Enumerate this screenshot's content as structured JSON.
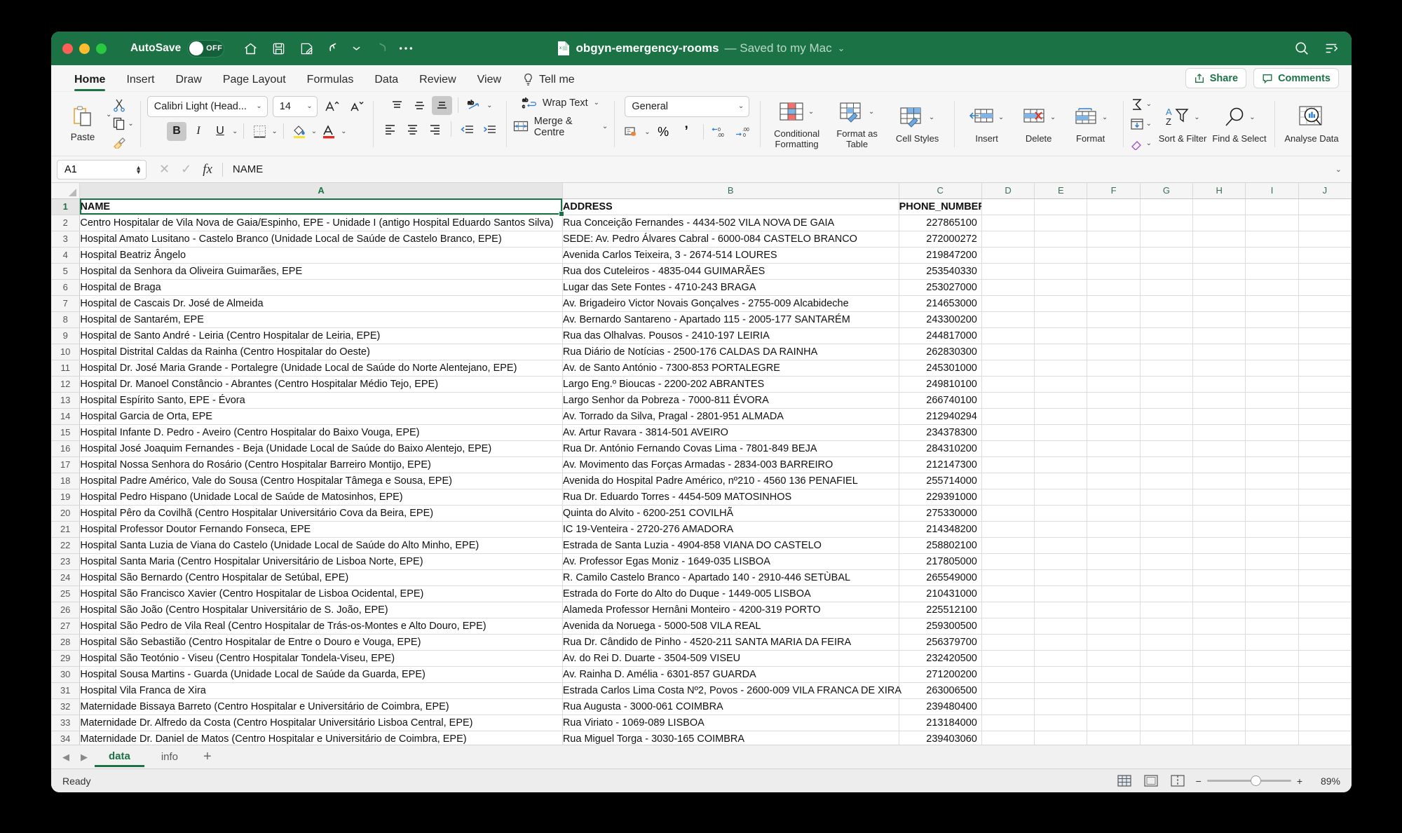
{
  "titlebar": {
    "autosave_label": "AutoSave",
    "autosave_state": "OFF",
    "doc_name": "obgyn-emergency-rooms",
    "doc_saved": "— Saved to my Mac",
    "quick_access": [
      "home-icon",
      "save-icon",
      "save-as-icon",
      "undo-icon",
      "redo-icon",
      "more-icon"
    ],
    "right_icons": [
      "search-icon",
      "ribbon-display-icon"
    ]
  },
  "tabs": [
    {
      "label": "Home",
      "active": true
    },
    {
      "label": "Insert",
      "active": false
    },
    {
      "label": "Draw",
      "active": false
    },
    {
      "label": "Page Layout",
      "active": false
    },
    {
      "label": "Formulas",
      "active": false
    },
    {
      "label": "Data",
      "active": false
    },
    {
      "label": "Review",
      "active": false
    },
    {
      "label": "View",
      "active": false
    }
  ],
  "tellme_label": "Tell me",
  "share_label": "Share",
  "comments_label": "Comments",
  "ribbon": {
    "paste_label": "Paste",
    "font_name": "Calibri Light (Head...",
    "font_size": "14",
    "bold_label": "B",
    "italic_label": "I",
    "underline_label": "U",
    "wrap_text_label": "Wrap Text",
    "merge_label": "Merge & Centre",
    "number_format": "General",
    "percent_label": "%",
    "comma_label": "’",
    "conditional_formatting_label": "Conditional Formatting",
    "format_as_table_label": "Format as Table",
    "cell_styles_label": "Cell Styles",
    "insert_label": "Insert",
    "delete_label": "Delete",
    "format_label": "Format",
    "sort_filter_label": "Sort & Filter",
    "find_select_label": "Find & Select",
    "analyse_data_label": "Analyse Data"
  },
  "formula_bar": {
    "name_box": "A1",
    "formula_value": "NAME"
  },
  "grid": {
    "columns": [
      "A",
      "B",
      "C",
      "D",
      "E",
      "F",
      "G",
      "H",
      "I",
      "J"
    ],
    "selected_column": "A",
    "selected_row": 1,
    "rows": [
      {
        "n": 1,
        "a": "NAME",
        "b": "ADDRESS",
        "c": "PHONE_NUMBER",
        "header": true
      },
      {
        "n": 2,
        "a": "Centro Hospitalar de Vila Nova de Gaia/Espinho, EPE - Unidade I (antigo Hospital Eduardo Santos Silva)",
        "b": "Rua Conceição Fernandes - 4434-502 VILA NOVA DE GAIA",
        "c": "227865100"
      },
      {
        "n": 3,
        "a": "Hospital Amato Lusitano - Castelo Branco (Unidade Local de Saúde de Castelo Branco, EPE)",
        "b": "SEDE: Av. Pedro Álvares Cabral - 6000-084 CASTELO BRANCO",
        "c": "272000272"
      },
      {
        "n": 4,
        "a": "Hospital Beatriz Ângelo",
        "b": "Avenida Carlos Teixeira, 3 - 2674-514 LOURES",
        "c": "219847200"
      },
      {
        "n": 5,
        "a": "Hospital da Senhora da Oliveira Guimarães, EPE",
        "b": "Rua dos Cuteleiros - 4835-044 GUIMARÃES",
        "c": "253540330"
      },
      {
        "n": 6,
        "a": "Hospital de Braga",
        "b": "Lugar das Sete Fontes - 4710-243 BRAGA",
        "c": "253027000"
      },
      {
        "n": 7,
        "a": "Hospital de Cascais Dr. José de Almeida",
        "b": "Av. Brigadeiro Victor Novais Gonçalves - 2755-009 Alcabideche",
        "c": "214653000"
      },
      {
        "n": 8,
        "a": "Hospital de Santarém, EPE",
        "b": "Av. Bernardo Santareno - Apartado 115 - 2005-177 SANTARÉM",
        "c": "243300200"
      },
      {
        "n": 9,
        "a": "Hospital de Santo André - Leiria (Centro Hospitalar de Leiria, EPE)",
        "b": "Rua das Olhalvas. Pousos - 2410-197 LEIRIA",
        "c": "244817000"
      },
      {
        "n": 10,
        "a": "Hospital Distrital Caldas da Rainha (Centro Hospitalar do Oeste)",
        "b": "Rua Diário de Notícias - 2500-176 CALDAS DA RAINHA",
        "c": "262830300"
      },
      {
        "n": 11,
        "a": "Hospital Dr. José Maria Grande - Portalegre (Unidade Local de Saúde do Norte Alentejano, EPE)",
        "b": "Av. de Santo António - 7300-853 PORTALEGRE",
        "c": "245301000"
      },
      {
        "n": 12,
        "a": "Hospital Dr. Manoel Constâncio - Abrantes (Centro Hospitalar Médio Tejo, EPE)",
        "b": "Largo Eng.º Bioucas - 2200-202 ABRANTES",
        "c": "249810100"
      },
      {
        "n": 13,
        "a": "Hospital Espírito Santo, EPE - Évora",
        "b": "Largo Senhor da Pobreza - 7000-811 ÉVORA",
        "c": "266740100"
      },
      {
        "n": 14,
        "a": "Hospital Garcia de Orta, EPE",
        "b": "Av. Torrado da Silva, Pragal - 2801-951 ALMADA",
        "c": "212940294"
      },
      {
        "n": 15,
        "a": "Hospital Infante D. Pedro - Aveiro (Centro Hospitalar do Baixo Vouga, EPE)",
        "b": "Av. Artur Ravara - 3814-501 AVEIRO",
        "c": "234378300"
      },
      {
        "n": 16,
        "a": "Hospital José Joaquim Fernandes - Beja (Unidade Local de Saúde do Baixo Alentejo, EPE)",
        "b": "Rua Dr. António Fernando Covas Lima - 7801-849 BEJA",
        "c": "284310200"
      },
      {
        "n": 17,
        "a": "Hospital Nossa Senhora do Rosário (Centro Hospitalar Barreiro Montijo, EPE)",
        "b": "Av. Movimento das Forças Armadas - 2834-003 BARREIRO",
        "c": "212147300"
      },
      {
        "n": 18,
        "a": "Hospital Padre Américo, Vale do Sousa (Centro Hospitalar Tâmega e Sousa, EPE)",
        "b": "Avenida do Hospital Padre Américo, nº210 - 4560 136 PENAFIEL",
        "c": "255714000"
      },
      {
        "n": 19,
        "a": "Hospital Pedro Hispano (Unidade Local de Saúde de Matosinhos, EPE)",
        "b": "Rua Dr. Eduardo Torres - 4454-509 MATOSINHOS",
        "c": "229391000"
      },
      {
        "n": 20,
        "a": "Hospital Pêro da Covilhã (Centro Hospitalar Universitário Cova da Beira, EPE)",
        "b": "Quinta do Alvito - 6200-251 COVILHÃ",
        "c": "275330000"
      },
      {
        "n": 21,
        "a": "Hospital Professor Doutor Fernando Fonseca, EPE",
        "b": "IC 19-Venteira - 2720-276 AMADORA",
        "c": "214348200"
      },
      {
        "n": 22,
        "a": "Hospital Santa Luzia de Viana do Castelo (Unidade Local de Saúde do Alto Minho, EPE)",
        "b": "Estrada de Santa Luzia - 4904-858 VIANA DO CASTELO",
        "c": "258802100"
      },
      {
        "n": 23,
        "a": "Hospital Santa Maria (Centro Hospitalar Universitário de Lisboa Norte, EPE)",
        "b": "Av. Professor Egas Moniz - 1649-035 LISBOA",
        "c": "217805000"
      },
      {
        "n": 24,
        "a": "Hospital São Bernardo (Centro Hospitalar de Setúbal, EPE)",
        "b": "R. Camilo Castelo Branco - Apartado 140 - 2910-446 SETÙBAL",
        "c": "265549000"
      },
      {
        "n": 25,
        "a": "Hospital São Francisco Xavier (Centro Hospitalar de Lisboa Ocidental, EPE)",
        "b": "Estrada do Forte do Alto do Duque - 1449-005 LISBOA",
        "c": "210431000"
      },
      {
        "n": 26,
        "a": "Hospital São João (Centro Hospitalar Universitário de S. João, EPE)",
        "b": "Alameda Professor Hernâni Monteiro - 4200-319 PORTO",
        "c": "225512100"
      },
      {
        "n": 27,
        "a": "Hospital São Pedro de Vila Real (Centro Hospitalar de Trás-os-Montes e Alto Douro, EPE)",
        "b": "Avenida da Noruega - 5000-508 VILA REAL",
        "c": "259300500"
      },
      {
        "n": 28,
        "a": "Hospital São Sebastião (Centro Hospitalar de Entre o Douro e Vouga, EPE)",
        "b": "Rua Dr. Cândido de Pinho - 4520-211 SANTA MARIA DA FEIRA",
        "c": "256379700"
      },
      {
        "n": 29,
        "a": "Hospital São Teotónio - Viseu (Centro Hospitalar Tondela-Viseu, EPE)",
        "b": "Av. do Rei D. Duarte - 3504-509 VISEU",
        "c": "232420500"
      },
      {
        "n": 30,
        "a": "Hospital Sousa Martins - Guarda (Unidade Local de Saúde da Guarda, EPE)",
        "b": "Av. Rainha D. Amélia - 6301-857 GUARDA",
        "c": "271200200"
      },
      {
        "n": 31,
        "a": "Hospital Vila Franca de Xira",
        "b": "Estrada Carlos Lima Costa Nº2, Povos - 2600-009  VILA FRANCA DE XIRA",
        "c": "263006500"
      },
      {
        "n": 32,
        "a": "Maternidade Bissaya Barreto (Centro Hospitalar e Universitário de Coimbra, EPE)",
        "b": "Rua Augusta - 3000-061 COIMBRA",
        "c": "239480400"
      },
      {
        "n": 33,
        "a": "Maternidade Dr. Alfredo da Costa (Centro Hospitalar Universitário Lisboa Central, EPE)",
        "b": " Rua Viriato - 1069-089 LISBOA",
        "c": "213184000"
      },
      {
        "n": 34,
        "a": "Maternidade Dr. Daniel de Matos (Centro Hospitalar e Universitário de Coimbra, EPE)",
        "b": "Rua Miguel Torga - 3030-165 COIMBRA",
        "c": "239403060"
      }
    ]
  },
  "sheet_tabs": [
    {
      "label": "data",
      "active": true
    },
    {
      "label": "info",
      "active": false
    }
  ],
  "status": {
    "message": "Ready",
    "zoom": "89%"
  },
  "colors": {
    "excel_green": "#1B7245",
    "accent_blue": "#2F7FD0",
    "selection_green": "#1B7245"
  }
}
